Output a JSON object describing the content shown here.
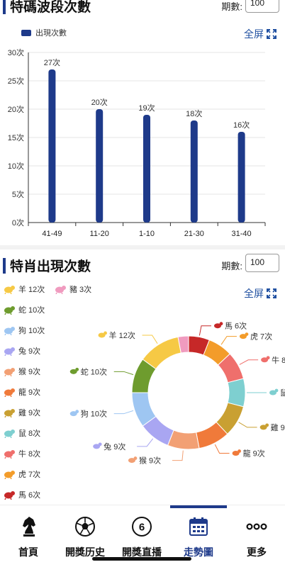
{
  "bar_section": {
    "title": "特碼波段次數",
    "period_label": "期數:",
    "period_value": "100",
    "fullscreen_label": "全屏",
    "legend_label": "出現次數"
  },
  "chart_data": [
    {
      "type": "bar",
      "categories": [
        "41-49",
        "11-20",
        "1-10",
        "21-30",
        "31-40"
      ],
      "series": [
        {
          "name": "出現次數",
          "values": [
            27,
            20,
            19,
            18,
            16
          ]
        }
      ],
      "data_labels": [
        "27次",
        "20次",
        "19次",
        "18次",
        "16次"
      ],
      "ytick_labels": [
        "0次",
        "5次",
        "10次",
        "15次",
        "20次",
        "25次",
        "30次"
      ],
      "ylim": [
        0,
        30
      ],
      "color": "#1e3a8a",
      "grid": true,
      "legend": "top-left"
    },
    {
      "type": "pie",
      "categories": [
        "馬",
        "虎",
        "牛",
        "鼠",
        "雞",
        "龍",
        "猴",
        "兔",
        "狗",
        "蛇",
        "羊",
        "豬"
      ],
      "values": [
        6,
        7,
        8,
        8,
        9,
        9,
        9,
        9,
        10,
        10,
        12,
        3
      ],
      "labels": [
        "馬 6次",
        "虎 7次",
        "牛 8次",
        "鼠 8次",
        "雞 9次",
        "龍 9次",
        "猴 9次",
        "兔 9次",
        "狗 10次",
        "蛇 10次",
        "羊 12次",
        "豬 3次"
      ],
      "colors": [
        "#c62828",
        "#f39c2a",
        "#ef6f6c",
        "#7ecfd0",
        "#c9a032",
        "#f07a3a",
        "#f2a074",
        "#a9a6f2",
        "#9ec6f2",
        "#6e9c2e",
        "#f6c945",
        "#f09bbf"
      ],
      "donut": true
    }
  ],
  "zodiac_section": {
    "title": "特肖出現次數",
    "period_label": "期數:",
    "period_value": "100",
    "fullscreen_label": "全屏",
    "legend_items": [
      {
        "label": "羊 12次",
        "icon": "goat-icon",
        "color": "#f6c945"
      },
      {
        "label": "豬 3次",
        "icon": "pig-icon",
        "color": "#f09bbf"
      },
      {
        "label": "蛇 10次",
        "icon": "snake-icon",
        "color": "#6e9c2e"
      },
      {
        "label": "狗 10次",
        "icon": "dog-icon",
        "color": "#9ec6f2"
      },
      {
        "label": "兔 9次",
        "icon": "rabbit-icon",
        "color": "#a9a6f2"
      },
      {
        "label": "猴 9次",
        "icon": "monkey-icon",
        "color": "#f2a074"
      },
      {
        "label": "龍 9次",
        "icon": "dragon-icon",
        "color": "#f07a3a"
      },
      {
        "label": "雞 9次",
        "icon": "rooster-icon",
        "color": "#c9a032"
      },
      {
        "label": "鼠 8次",
        "icon": "rat-icon",
        "color": "#7ecfd0"
      },
      {
        "label": "牛 8次",
        "icon": "ox-icon",
        "color": "#ef6f6c"
      },
      {
        "label": "虎 7次",
        "icon": "tiger-icon",
        "color": "#f39c2a"
      },
      {
        "label": "馬 6次",
        "icon": "horse-icon",
        "color": "#c62828"
      }
    ]
  },
  "tabbar": {
    "tabs": [
      {
        "label": "首頁",
        "icon": "chess-knight-icon"
      },
      {
        "label": "開獎历史",
        "icon": "soccer-ball-icon"
      },
      {
        "label": "開獎直播",
        "icon": "number-six-ball-icon",
        "glyph": "6"
      },
      {
        "label": "走勢圖",
        "icon": "calendar-icon"
      },
      {
        "label": "更多",
        "icon": "more-dots-icon",
        "glyph": "ooo"
      }
    ],
    "active_index": 3
  }
}
